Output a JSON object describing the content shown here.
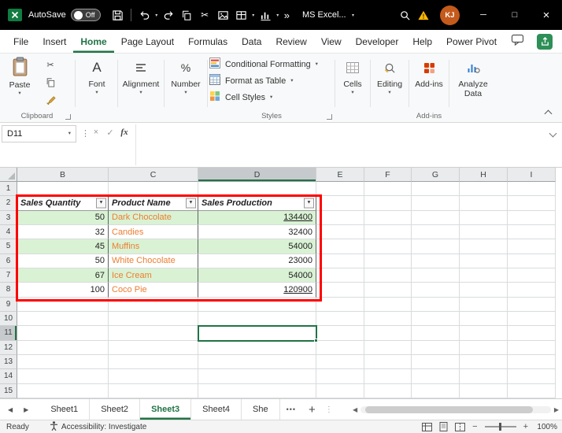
{
  "colors": {
    "accent_green": "#217346",
    "band_green": "#d9f2d4",
    "product_orange": "#ed7d31",
    "annotation_red": "#ff0000",
    "addins_red": "#d83b01",
    "warning_yellow": "#ffb900",
    "avatar_orange": "#c45a1c",
    "titlebar_black": "#000000"
  },
  "icons": {
    "dropdown": "▾",
    "more_commands": "»",
    "vertical_dots": "⋮",
    "minimize": "─",
    "maximize": "□",
    "close": "×",
    "cancel": "×",
    "enter": "✓",
    "filter_arrow": "▼",
    "triangle_left": "◀",
    "triangle_right": "▶",
    "zoom_out": "−",
    "zoom_in": "+",
    "cut_scissors": "✂"
  },
  "title_bar": {
    "autosave_label": "AutoSave",
    "autosave_state": "Off",
    "app_dropdown_label": "MS Excel...",
    "avatar_initials": "KJ"
  },
  "menu": {
    "items": [
      "File",
      "Insert",
      "Home",
      "Page Layout",
      "Formulas",
      "Data",
      "Review",
      "View",
      "Developer",
      "Help",
      "Power Pivot"
    ],
    "active_index": 2
  },
  "ribbon": {
    "paste_label": "Paste",
    "font_label": "Font",
    "alignment_label": "Alignment",
    "number_label": "Number",
    "styles_items": [
      "Conditional Formatting",
      "Format as Table",
      "Cell Styles"
    ],
    "cells_label": "Cells",
    "editing_label": "Editing",
    "addins_button_label": "Add-ins",
    "analyze_line1": "Analyze",
    "analyze_line2": "Data",
    "group_labels": {
      "clipboard": "Clipboard",
      "styles": "Styles",
      "addins": "Add-ins"
    }
  },
  "formula_bar": {
    "name_box_value": "D11",
    "formula_value": "",
    "fx_label": "fx"
  },
  "grid": {
    "columns": [
      "B",
      "C",
      "D",
      "E",
      "F",
      "G",
      "H",
      "I"
    ],
    "rows": [
      "1",
      "2",
      "3",
      "4",
      "5",
      "6",
      "7",
      "8",
      "9",
      "10",
      "11",
      "12",
      "13",
      "14",
      "15"
    ],
    "active_col": "D",
    "active_row": 11,
    "active_cell": "D11"
  },
  "table": {
    "headers": [
      "Sales Quantity",
      "Product Name",
      "Sales Production"
    ],
    "rows": [
      {
        "sales_quantity": "50",
        "product_name": "Dark Chocolate",
        "sales_production": "134400",
        "production_underlined": true
      },
      {
        "sales_quantity": "32",
        "product_name": "Candies",
        "sales_production": "32400",
        "production_underlined": false
      },
      {
        "sales_quantity": "45",
        "product_name": "Muffins",
        "sales_production": "54000",
        "production_underlined": false
      },
      {
        "sales_quantity": "50",
        "product_name": "White Chocolate",
        "sales_production": "23000",
        "production_underlined": false
      },
      {
        "sales_quantity": "67",
        "product_name": "Ice Cream",
        "sales_production": "54000",
        "production_underlined": false
      },
      {
        "sales_quantity": "100",
        "product_name": "Coco Pie",
        "sales_production": "120900",
        "production_underlined": true
      }
    ]
  },
  "sheet_tabs": {
    "tabs": [
      {
        "label": "Sheet1",
        "active": false
      },
      {
        "label": "Sheet2",
        "active": false
      },
      {
        "label": "Sheet3",
        "active": true
      },
      {
        "label": "Sheet4",
        "active": false
      },
      {
        "label": "She",
        "active": false
      }
    ],
    "more_label": "•••",
    "add_label": "+"
  },
  "status_bar": {
    "ready_label": "Ready",
    "accessibility_label": "Accessibility: Investigate",
    "zoom_level": "100%"
  }
}
